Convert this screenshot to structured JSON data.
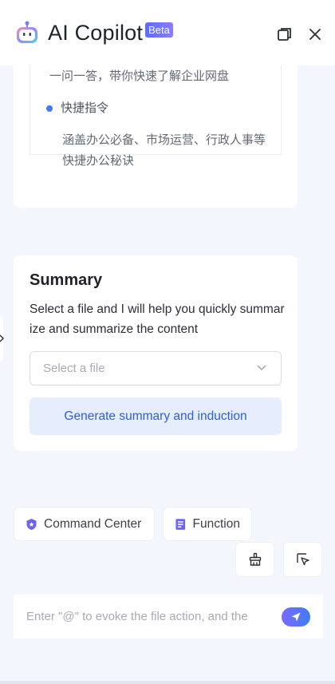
{
  "header": {
    "title": "AI Copilot",
    "badge": "Beta",
    "logo_icon": "robot-icon",
    "copy_icon": "copy-window-icon",
    "close_icon": "close-icon"
  },
  "intro": {
    "line1": "一问一答，带你快速了解企业网盘",
    "bullet_label": "快捷指令",
    "description": "涵盖办公必备、市场运营、行政人事等快捷办公秘诀"
  },
  "summary": {
    "title": "Summary",
    "description": "Select a file and I will help you quickly summarize and summarize the content",
    "select_placeholder": "Select a file",
    "generate_label": "Generate summary and induction"
  },
  "chips": {
    "command_center": "Command Center",
    "function": "Function"
  },
  "tools": {
    "tool_a_icon": "broom-icon",
    "tool_b_icon": "cursor-select-icon"
  },
  "input": {
    "placeholder": "Enter \"@\" to evoke the file action, and the"
  },
  "colors": {
    "accent": "#3f7bf3",
    "background": "#f4f6fe",
    "button_bg": "#e6edfd"
  }
}
